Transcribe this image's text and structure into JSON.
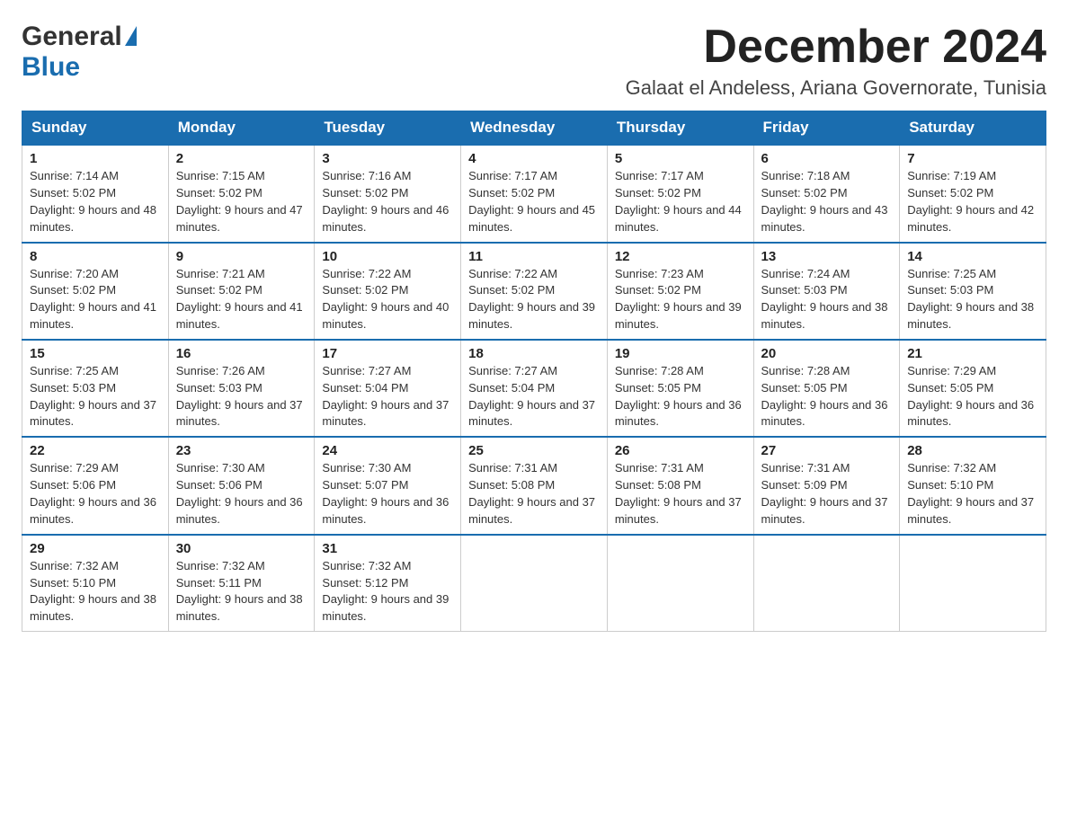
{
  "logo": {
    "general": "General",
    "blue": "Blue"
  },
  "header": {
    "title": "December 2024",
    "location": "Galaat el Andeless, Ariana Governorate, Tunisia"
  },
  "weekdays": [
    "Sunday",
    "Monday",
    "Tuesday",
    "Wednesday",
    "Thursday",
    "Friday",
    "Saturday"
  ],
  "weeks": [
    [
      {
        "day": "1",
        "sunrise": "7:14 AM",
        "sunset": "5:02 PM",
        "daylight": "9 hours and 48 minutes."
      },
      {
        "day": "2",
        "sunrise": "7:15 AM",
        "sunset": "5:02 PM",
        "daylight": "9 hours and 47 minutes."
      },
      {
        "day": "3",
        "sunrise": "7:16 AM",
        "sunset": "5:02 PM",
        "daylight": "9 hours and 46 minutes."
      },
      {
        "day": "4",
        "sunrise": "7:17 AM",
        "sunset": "5:02 PM",
        "daylight": "9 hours and 45 minutes."
      },
      {
        "day": "5",
        "sunrise": "7:17 AM",
        "sunset": "5:02 PM",
        "daylight": "9 hours and 44 minutes."
      },
      {
        "day": "6",
        "sunrise": "7:18 AM",
        "sunset": "5:02 PM",
        "daylight": "9 hours and 43 minutes."
      },
      {
        "day": "7",
        "sunrise": "7:19 AM",
        "sunset": "5:02 PM",
        "daylight": "9 hours and 42 minutes."
      }
    ],
    [
      {
        "day": "8",
        "sunrise": "7:20 AM",
        "sunset": "5:02 PM",
        "daylight": "9 hours and 41 minutes."
      },
      {
        "day": "9",
        "sunrise": "7:21 AM",
        "sunset": "5:02 PM",
        "daylight": "9 hours and 41 minutes."
      },
      {
        "day": "10",
        "sunrise": "7:22 AM",
        "sunset": "5:02 PM",
        "daylight": "9 hours and 40 minutes."
      },
      {
        "day": "11",
        "sunrise": "7:22 AM",
        "sunset": "5:02 PM",
        "daylight": "9 hours and 39 minutes."
      },
      {
        "day": "12",
        "sunrise": "7:23 AM",
        "sunset": "5:02 PM",
        "daylight": "9 hours and 39 minutes."
      },
      {
        "day": "13",
        "sunrise": "7:24 AM",
        "sunset": "5:03 PM",
        "daylight": "9 hours and 38 minutes."
      },
      {
        "day": "14",
        "sunrise": "7:25 AM",
        "sunset": "5:03 PM",
        "daylight": "9 hours and 38 minutes."
      }
    ],
    [
      {
        "day": "15",
        "sunrise": "7:25 AM",
        "sunset": "5:03 PM",
        "daylight": "9 hours and 37 minutes."
      },
      {
        "day": "16",
        "sunrise": "7:26 AM",
        "sunset": "5:03 PM",
        "daylight": "9 hours and 37 minutes."
      },
      {
        "day": "17",
        "sunrise": "7:27 AM",
        "sunset": "5:04 PM",
        "daylight": "9 hours and 37 minutes."
      },
      {
        "day": "18",
        "sunrise": "7:27 AM",
        "sunset": "5:04 PM",
        "daylight": "9 hours and 37 minutes."
      },
      {
        "day": "19",
        "sunrise": "7:28 AM",
        "sunset": "5:05 PM",
        "daylight": "9 hours and 36 minutes."
      },
      {
        "day": "20",
        "sunrise": "7:28 AM",
        "sunset": "5:05 PM",
        "daylight": "9 hours and 36 minutes."
      },
      {
        "day": "21",
        "sunrise": "7:29 AM",
        "sunset": "5:05 PM",
        "daylight": "9 hours and 36 minutes."
      }
    ],
    [
      {
        "day": "22",
        "sunrise": "7:29 AM",
        "sunset": "5:06 PM",
        "daylight": "9 hours and 36 minutes."
      },
      {
        "day": "23",
        "sunrise": "7:30 AM",
        "sunset": "5:06 PM",
        "daylight": "9 hours and 36 minutes."
      },
      {
        "day": "24",
        "sunrise": "7:30 AM",
        "sunset": "5:07 PM",
        "daylight": "9 hours and 36 minutes."
      },
      {
        "day": "25",
        "sunrise": "7:31 AM",
        "sunset": "5:08 PM",
        "daylight": "9 hours and 37 minutes."
      },
      {
        "day": "26",
        "sunrise": "7:31 AM",
        "sunset": "5:08 PM",
        "daylight": "9 hours and 37 minutes."
      },
      {
        "day": "27",
        "sunrise": "7:31 AM",
        "sunset": "5:09 PM",
        "daylight": "9 hours and 37 minutes."
      },
      {
        "day": "28",
        "sunrise": "7:32 AM",
        "sunset": "5:10 PM",
        "daylight": "9 hours and 37 minutes."
      }
    ],
    [
      {
        "day": "29",
        "sunrise": "7:32 AM",
        "sunset": "5:10 PM",
        "daylight": "9 hours and 38 minutes."
      },
      {
        "day": "30",
        "sunrise": "7:32 AM",
        "sunset": "5:11 PM",
        "daylight": "9 hours and 38 minutes."
      },
      {
        "day": "31",
        "sunrise": "7:32 AM",
        "sunset": "5:12 PM",
        "daylight": "9 hours and 39 minutes."
      },
      null,
      null,
      null,
      null
    ]
  ]
}
